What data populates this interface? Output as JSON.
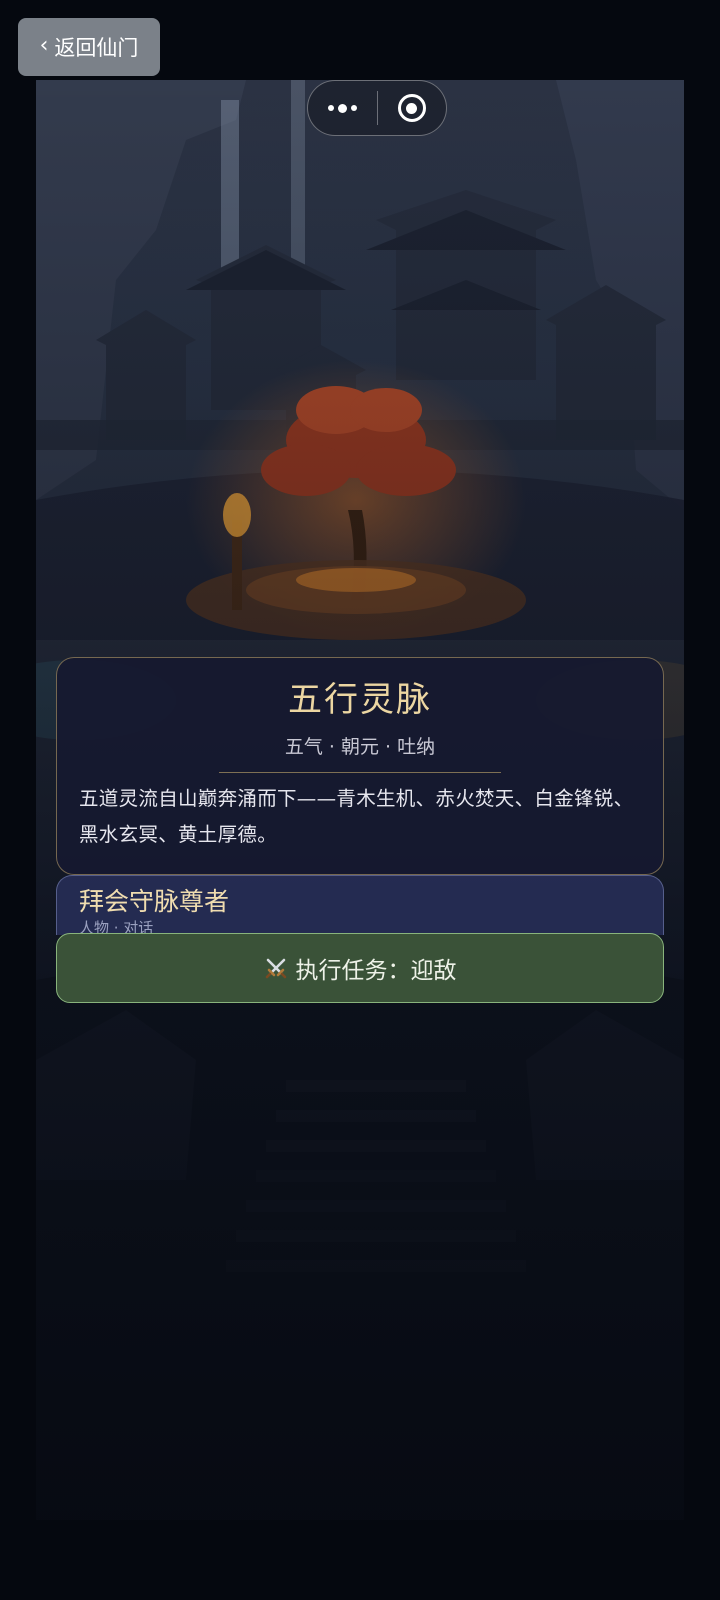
{
  "nav": {
    "back_label": "返回仙门"
  },
  "location": {
    "title": "五行灵脉",
    "tags": "五气 · 朝元 · 吐纳",
    "description": "五道灵流自山巅奔涌而下——青木生机、赤火焚天、白金锋锐、黑水玄冥、黄土厚德。"
  },
  "npc": {
    "name": "拜会守脉尊者",
    "subtitle": "人物 · 对话"
  },
  "task": {
    "icon": "crossed-swords-icon",
    "label": "执行任务：迎敌"
  },
  "capsule": {
    "more_icon": "more-dots-icon",
    "close_icon": "target-circle-icon"
  },
  "colors": {
    "gold_text": "#ecd6a2",
    "card_bg": "#161930",
    "task_bg": "#3a5238",
    "task_border": "#89b47c"
  }
}
